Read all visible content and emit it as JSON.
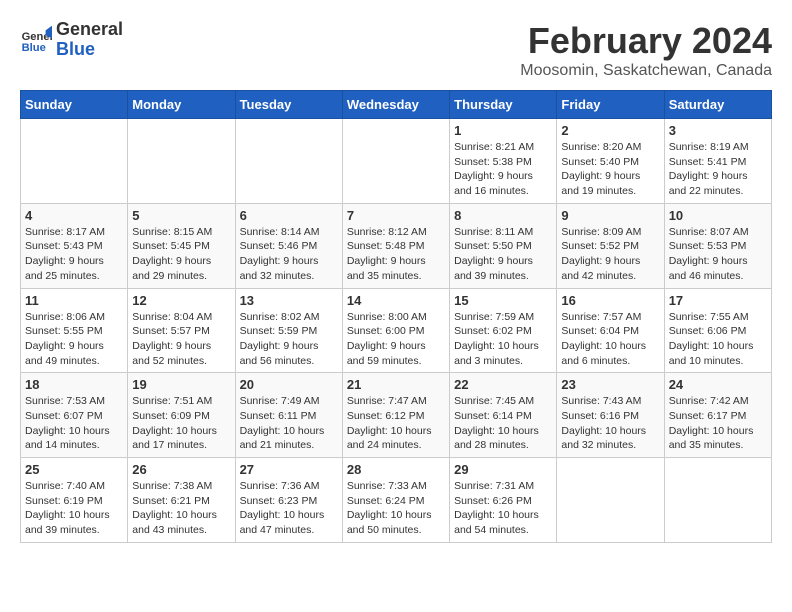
{
  "header": {
    "logo_line1": "General",
    "logo_line2": "Blue",
    "month_title": "February 2024",
    "location": "Moosomin, Saskatchewan, Canada"
  },
  "days_of_week": [
    "Sunday",
    "Monday",
    "Tuesday",
    "Wednesday",
    "Thursday",
    "Friday",
    "Saturday"
  ],
  "weeks": [
    {
      "days": [
        {
          "number": "",
          "info": ""
        },
        {
          "number": "",
          "info": ""
        },
        {
          "number": "",
          "info": ""
        },
        {
          "number": "",
          "info": ""
        },
        {
          "number": "1",
          "info": "Sunrise: 8:21 AM\nSunset: 5:38 PM\nDaylight: 9 hours\nand 16 minutes."
        },
        {
          "number": "2",
          "info": "Sunrise: 8:20 AM\nSunset: 5:40 PM\nDaylight: 9 hours\nand 19 minutes."
        },
        {
          "number": "3",
          "info": "Sunrise: 8:19 AM\nSunset: 5:41 PM\nDaylight: 9 hours\nand 22 minutes."
        }
      ]
    },
    {
      "days": [
        {
          "number": "4",
          "info": "Sunrise: 8:17 AM\nSunset: 5:43 PM\nDaylight: 9 hours\nand 25 minutes."
        },
        {
          "number": "5",
          "info": "Sunrise: 8:15 AM\nSunset: 5:45 PM\nDaylight: 9 hours\nand 29 minutes."
        },
        {
          "number": "6",
          "info": "Sunrise: 8:14 AM\nSunset: 5:46 PM\nDaylight: 9 hours\nand 32 minutes."
        },
        {
          "number": "7",
          "info": "Sunrise: 8:12 AM\nSunset: 5:48 PM\nDaylight: 9 hours\nand 35 minutes."
        },
        {
          "number": "8",
          "info": "Sunrise: 8:11 AM\nSunset: 5:50 PM\nDaylight: 9 hours\nand 39 minutes."
        },
        {
          "number": "9",
          "info": "Sunrise: 8:09 AM\nSunset: 5:52 PM\nDaylight: 9 hours\nand 42 minutes."
        },
        {
          "number": "10",
          "info": "Sunrise: 8:07 AM\nSunset: 5:53 PM\nDaylight: 9 hours\nand 46 minutes."
        }
      ]
    },
    {
      "days": [
        {
          "number": "11",
          "info": "Sunrise: 8:06 AM\nSunset: 5:55 PM\nDaylight: 9 hours\nand 49 minutes."
        },
        {
          "number": "12",
          "info": "Sunrise: 8:04 AM\nSunset: 5:57 PM\nDaylight: 9 hours\nand 52 minutes."
        },
        {
          "number": "13",
          "info": "Sunrise: 8:02 AM\nSunset: 5:59 PM\nDaylight: 9 hours\nand 56 minutes."
        },
        {
          "number": "14",
          "info": "Sunrise: 8:00 AM\nSunset: 6:00 PM\nDaylight: 9 hours\nand 59 minutes."
        },
        {
          "number": "15",
          "info": "Sunrise: 7:59 AM\nSunset: 6:02 PM\nDaylight: 10 hours\nand 3 minutes."
        },
        {
          "number": "16",
          "info": "Sunrise: 7:57 AM\nSunset: 6:04 PM\nDaylight: 10 hours\nand 6 minutes."
        },
        {
          "number": "17",
          "info": "Sunrise: 7:55 AM\nSunset: 6:06 PM\nDaylight: 10 hours\nand 10 minutes."
        }
      ]
    },
    {
      "days": [
        {
          "number": "18",
          "info": "Sunrise: 7:53 AM\nSunset: 6:07 PM\nDaylight: 10 hours\nand 14 minutes."
        },
        {
          "number": "19",
          "info": "Sunrise: 7:51 AM\nSunset: 6:09 PM\nDaylight: 10 hours\nand 17 minutes."
        },
        {
          "number": "20",
          "info": "Sunrise: 7:49 AM\nSunset: 6:11 PM\nDaylight: 10 hours\nand 21 minutes."
        },
        {
          "number": "21",
          "info": "Sunrise: 7:47 AM\nSunset: 6:12 PM\nDaylight: 10 hours\nand 24 minutes."
        },
        {
          "number": "22",
          "info": "Sunrise: 7:45 AM\nSunset: 6:14 PM\nDaylight: 10 hours\nand 28 minutes."
        },
        {
          "number": "23",
          "info": "Sunrise: 7:43 AM\nSunset: 6:16 PM\nDaylight: 10 hours\nand 32 minutes."
        },
        {
          "number": "24",
          "info": "Sunrise: 7:42 AM\nSunset: 6:17 PM\nDaylight: 10 hours\nand 35 minutes."
        }
      ]
    },
    {
      "days": [
        {
          "number": "25",
          "info": "Sunrise: 7:40 AM\nSunset: 6:19 PM\nDaylight: 10 hours\nand 39 minutes."
        },
        {
          "number": "26",
          "info": "Sunrise: 7:38 AM\nSunset: 6:21 PM\nDaylight: 10 hours\nand 43 minutes."
        },
        {
          "number": "27",
          "info": "Sunrise: 7:36 AM\nSunset: 6:23 PM\nDaylight: 10 hours\nand 47 minutes."
        },
        {
          "number": "28",
          "info": "Sunrise: 7:33 AM\nSunset: 6:24 PM\nDaylight: 10 hours\nand 50 minutes."
        },
        {
          "number": "29",
          "info": "Sunrise: 7:31 AM\nSunset: 6:26 PM\nDaylight: 10 hours\nand 54 minutes."
        },
        {
          "number": "",
          "info": ""
        },
        {
          "number": "",
          "info": ""
        }
      ]
    }
  ]
}
